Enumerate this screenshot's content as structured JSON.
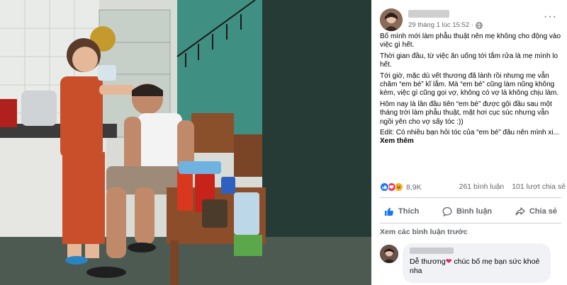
{
  "post": {
    "date": "29 tháng 1 lúc 15:52",
    "privacy_icon": "globe-icon",
    "more_icon": "more-icon",
    "paragraphs": [
      "Bố mình mới làm phẫu thuật nên mẹ không cho động vào việc gì hết.",
      "Thời gian đầu, từ việc ăn uống tới tắm rửa là mẹ mình lo hết.",
      "Tới giờ, mặc dù vết thương đã lành rồi nhưng mẹ vẫn chăm “em bé” kĩ lắm. Mà “em bé” cũng làm nũng không kém, việc gì cũng gọi vợ, không có vợ là không chịu làm.",
      "Hôm nay là lần đầu tiên “em bé” được gội đầu sau một tháng trời làm phẫu thuật, mặt hơi cục súc nhưng vẫn ngồi yên cho vợ sấy tóc :))"
    ],
    "truncated_line": "Edit: Có nhiều bạn hỏi tóc của “em bé” đâu nên mình xi...",
    "see_more": "Xem thêm"
  },
  "stats": {
    "reaction_icons": [
      "like-reaction-icon",
      "love-reaction-icon",
      "haha-reaction-icon"
    ],
    "reaction_count": "8,9K",
    "comment_count": "261 bình luận",
    "share_count": "101 lượt chia sẻ"
  },
  "actions": {
    "like": "Thích",
    "comment": "Bình luận",
    "share": "Chia sẻ"
  },
  "comments": {
    "view_previous": "Xem các bình luận trước",
    "items": [
      {
        "text_before": "Dễ thương",
        "text_after": " chúc bố mẹ bạn sức khoẻ nha"
      }
    ]
  },
  "colors": {
    "facebook_blue": "#1877f2",
    "love_red": "#f33e58",
    "haha_yellow": "#f7b125",
    "secondary_text": "#65676b",
    "comment_bubble": "#f0f2f5"
  }
}
